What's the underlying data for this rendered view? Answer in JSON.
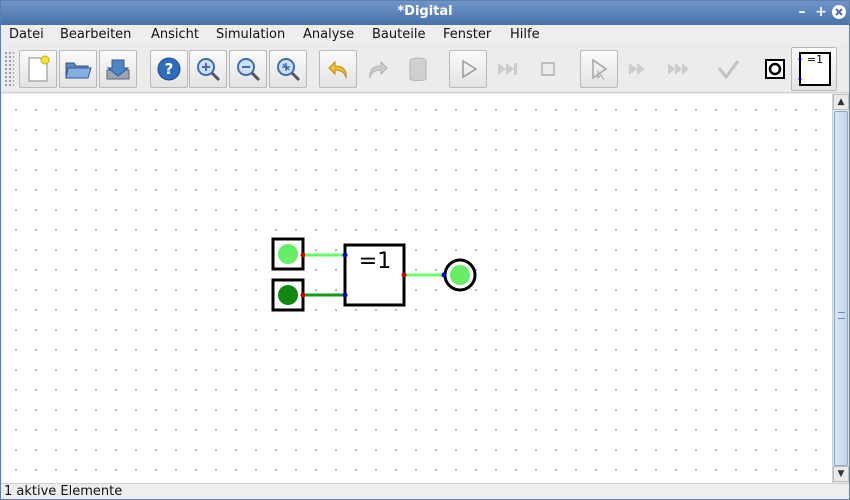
{
  "window": {
    "title": "*Digital"
  },
  "menu": [
    "Datei",
    "Bearbeiten",
    "Ansicht",
    "Simulation",
    "Analyse",
    "Bauteile",
    "Fenster",
    "Hilfe"
  ],
  "toolbar": {
    "xor_preview_label": "=1"
  },
  "circuit": {
    "gate_label": "=1",
    "input_a_state": "high",
    "input_b_state": "low",
    "output_state": "high"
  },
  "status": {
    "text": "1 aktive Elemente"
  },
  "colors": {
    "wire_high": "#66ff66",
    "wire_low": "#119911",
    "led_high": "#66ee66",
    "led_low": "#118811",
    "pin_out": "#cc0000",
    "pin_in": "#0000cc"
  }
}
